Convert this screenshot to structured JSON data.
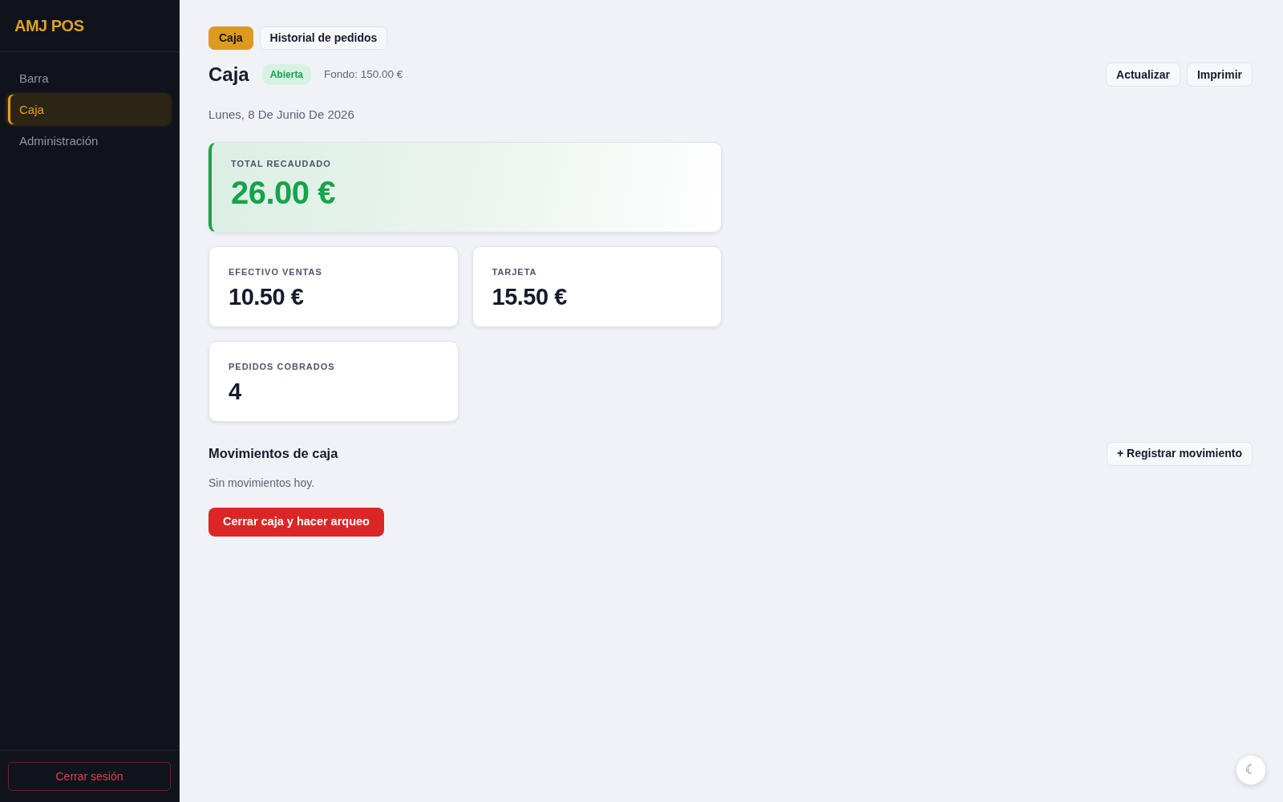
{
  "sidebar": {
    "logo": "AMJ POS",
    "items": [
      {
        "label": "Barra",
        "selected": false
      },
      {
        "label": "Caja",
        "selected": true
      },
      {
        "label": "Administración",
        "selected": false
      }
    ],
    "logout_button": "Cerrar sesión"
  },
  "tabs": [
    {
      "label": "Caja",
      "selected": true
    },
    {
      "label": "Historial de pedidos",
      "selected": false
    }
  ],
  "header": {
    "title": "Caja",
    "status_badge": {
      "label": "Abierta",
      "kind": "open"
    },
    "fund": "Fondo: 150.00 €",
    "buttons": [
      "Actualizar",
      "Imprimir"
    ]
  },
  "date": "Lunes, 8 De Junio De 2026",
  "summary": {
    "total": {
      "label": "TOTAL RECAUDADO",
      "value": "26.00 €"
    },
    "cards": [
      {
        "label": "EFECTIVO VENTAS",
        "value": "10.50 €"
      },
      {
        "label": "TARJETA",
        "value": "15.50 €"
      },
      {
        "label": "PEDIDOS COBRADOS",
        "value": "4"
      }
    ]
  },
  "movements": {
    "title": "Movimientos de caja",
    "add_button": "+ Registrar movimiento",
    "empty_text": "Sin movimientos hoy."
  },
  "close_button": "Cerrar caja y hacer arqueo",
  "theme_toggle": "☾"
}
